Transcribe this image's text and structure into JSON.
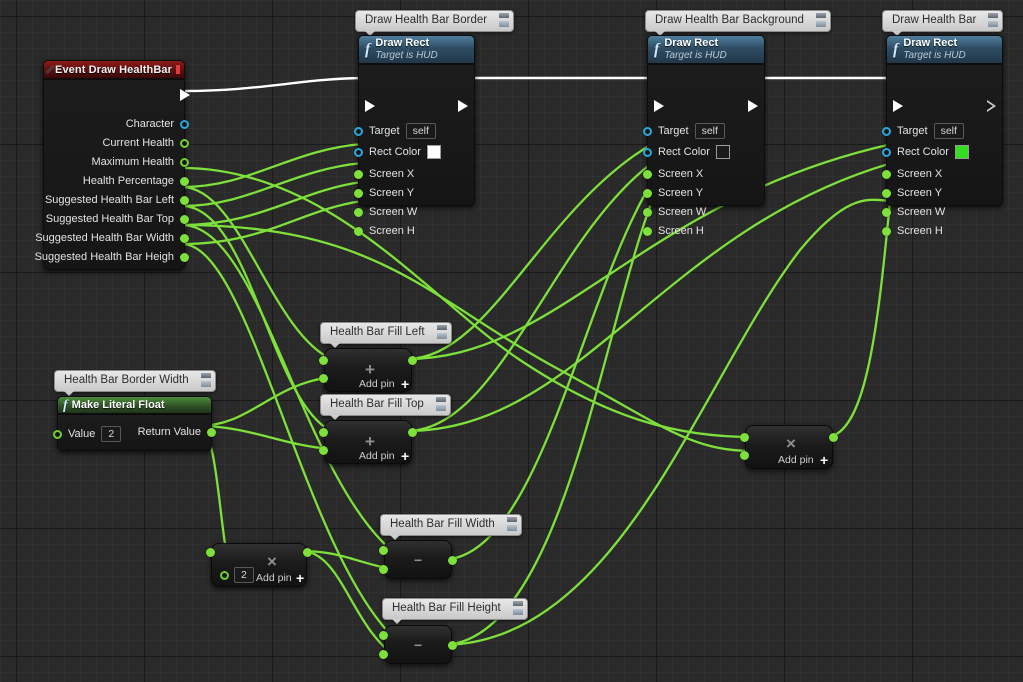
{
  "app": {
    "title": "Unreal Engine Blueprint Event Graph",
    "background": "#2a2a2a",
    "wire_colors": {
      "exec": "#ffffff",
      "float": "#7ee03a"
    }
  },
  "nodes": {
    "event": {
      "comment": null,
      "title": "Event Draw HealthBar",
      "header_color": "#7a1717",
      "icon": "diamond-icon",
      "delegate_pin": "delegate-output-pin",
      "exec_out": "",
      "outputs": [
        {
          "label": "Character",
          "type": "object",
          "color": "#25a7e0"
        },
        {
          "label": "Current Health",
          "type": "float-ref",
          "color": "#6fd02e"
        },
        {
          "label": "Maximum Health",
          "type": "float-ref",
          "color": "#6fd02e"
        },
        {
          "label": "Health Percentage",
          "type": "float",
          "color": "#7ee03a"
        },
        {
          "label": "Suggested Health Bar Left",
          "type": "float",
          "color": "#7ee03a"
        },
        {
          "label": "Suggested Health Bar Top",
          "type": "float",
          "color": "#7ee03a"
        },
        {
          "label": "Suggested Health Bar Width",
          "type": "float",
          "color": "#7ee03a"
        },
        {
          "label": "Suggested Health Bar Heigh",
          "type": "float",
          "color": "#7ee03a"
        }
      ]
    },
    "draw_border": {
      "comment": "Draw Health Bar Border",
      "title": "Draw Rect",
      "subtitle": "Target is HUD",
      "icon": "function-icon",
      "target_label": "Target",
      "target_value": "self",
      "rect_color_label": "Rect Color",
      "rect_color_value": "#ffffff",
      "inputs": [
        "Screen X",
        "Screen Y",
        "Screen W",
        "Screen H"
      ]
    },
    "draw_background": {
      "comment": "Draw Health Bar Background",
      "title": "Draw Rect",
      "subtitle": "Target is HUD",
      "icon": "function-icon",
      "target_label": "Target",
      "target_value": "self",
      "rect_color_label": "Rect Color",
      "rect_color_value": "#1a1a1a",
      "inputs": [
        "Screen X",
        "Screen Y",
        "Screen W",
        "Screen H"
      ]
    },
    "draw_bar": {
      "comment": "Draw Health Bar",
      "title": "Draw Rect",
      "subtitle": "Target is HUD",
      "icon": "function-icon",
      "target_label": "Target",
      "target_value": "self",
      "rect_color_label": "Rect Color",
      "rect_color_value": "#33dd22",
      "inputs": [
        "Screen X",
        "Screen Y",
        "Screen W",
        "Screen H"
      ]
    },
    "border_width_literal": {
      "comment": "Health Bar Border Width",
      "title": "Make Literal Float",
      "icon": "function-icon",
      "input_label": "Value",
      "input_value": "2",
      "output_label": "Return Value"
    },
    "fill_left": {
      "comment": "Health Bar Fill Left",
      "operator": "+",
      "add_pin_label": "Add pin",
      "inputs": 2,
      "outputs": 1
    },
    "fill_top": {
      "comment": "Health Bar Fill Top",
      "operator": "+",
      "add_pin_label": "Add pin",
      "inputs": 2,
      "outputs": 1
    },
    "border_times_two": {
      "comment": null,
      "operator": "×",
      "add_pin_label": "Add pin",
      "literal_value": "2",
      "inputs": 2,
      "outputs": 1
    },
    "percent_times_width": {
      "comment": null,
      "operator": "×",
      "add_pin_label": "Add pin",
      "inputs": 2,
      "outputs": 1
    },
    "fill_width": {
      "comment": "Health Bar Fill Width",
      "operator": "−",
      "inputs": 2,
      "outputs": 1
    },
    "fill_height": {
      "comment": "Health Bar Fill Height",
      "operator": "−",
      "inputs": 2,
      "outputs": 1
    }
  }
}
